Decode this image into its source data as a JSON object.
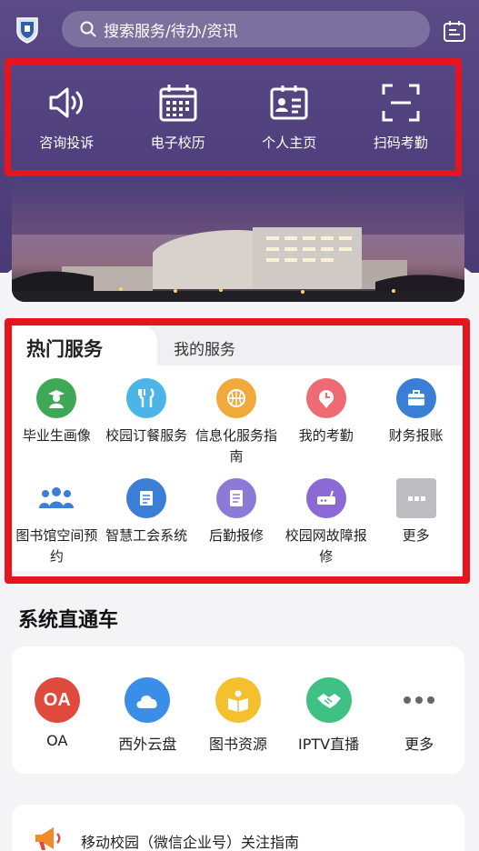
{
  "search": {
    "placeholder": "搜索服务/待办/资讯"
  },
  "quick_actions": [
    {
      "label": "咨询投诉",
      "icon": "speaker-icon"
    },
    {
      "label": "电子校历",
      "icon": "calendar-icon"
    },
    {
      "label": "个人主页",
      "icon": "id-card-icon"
    },
    {
      "label": "扫码考勤",
      "icon": "scan-icon"
    }
  ],
  "services": {
    "tabs": {
      "hot": "热门服务",
      "mine": "我的服务"
    },
    "items": [
      {
        "label": "毕业生画像",
        "icon": "graduate-icon",
        "color": "#3fa857"
      },
      {
        "label": "校园订餐服务",
        "icon": "dining-icon",
        "color": "#4cb4e6"
      },
      {
        "label": "信息化服务指南",
        "icon": "basketball-icon",
        "color": "#f2a93b"
      },
      {
        "label": "我的考勤",
        "icon": "clock-pin-icon",
        "color": "#ef6b74"
      },
      {
        "label": "财务报账",
        "icon": "briefcase-icon",
        "color": "#3a7fd5"
      },
      {
        "label": "图书馆空间预约",
        "icon": "group-icon",
        "color": "#3a7fd5"
      },
      {
        "label": "智慧工会系统",
        "icon": "document-icon",
        "color": "#3a7fd5"
      },
      {
        "label": "后勤报修",
        "icon": "form-icon",
        "color": "#8b7ad6"
      },
      {
        "label": "校园网故障报修",
        "icon": "router-icon",
        "color": "#8b6ad6"
      },
      {
        "label": "更多",
        "icon": "more-icon",
        "color": "#bdbdc2"
      }
    ]
  },
  "system": {
    "title": "系统直通车",
    "items": [
      {
        "label": "OA",
        "icon": "oa-icon",
        "color": "#e04a3c"
      },
      {
        "label": "西外云盘",
        "icon": "cloud-icon",
        "color": "#3b8ee8"
      },
      {
        "label": "图书资源",
        "icon": "book-icon",
        "color": "#f4c02e"
      },
      {
        "label": "IPTV直播",
        "icon": "handshake-icon",
        "color": "#3fc084"
      },
      {
        "label": "更多",
        "icon": "more-dots-icon",
        "color": "#666666"
      }
    ],
    "oa_badge": "OA"
  },
  "notice": {
    "text": "移动校园（微信企业号）关注指南"
  }
}
